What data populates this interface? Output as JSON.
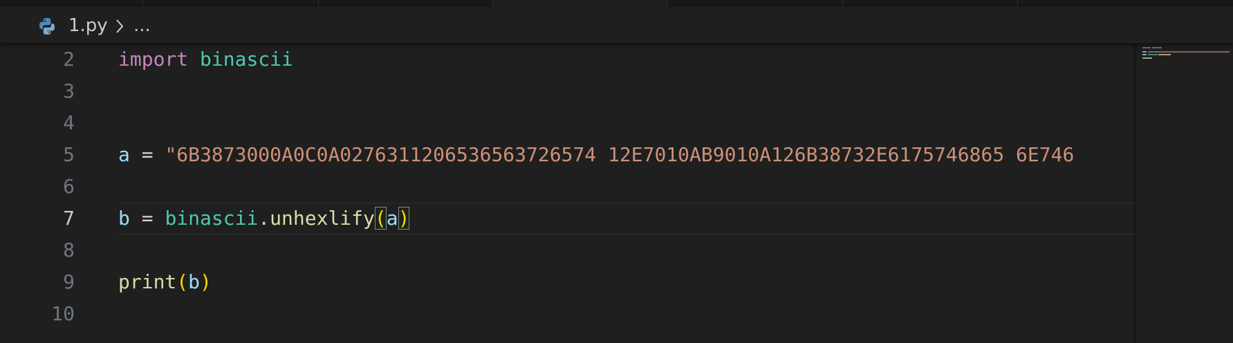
{
  "breadcrumb": {
    "file_name": "1.py",
    "ellipsis": "...",
    "file_icon": "python-icon",
    "separator_icon": "chevron-right-icon"
  },
  "editor": {
    "active_line": "7",
    "line_numbers": [
      "2",
      "3",
      "4",
      "5",
      "6",
      "7",
      "8",
      "9",
      "10"
    ],
    "lines": {
      "l2": {
        "kw": "import",
        "sp": " ",
        "mod": "binascii"
      },
      "l5": {
        "var": "a",
        "eq": " = ",
        "str": "\"6B3873000A0C0A0276311206536563726574 12E7010AB9010A126B38732E6175746865 6E746"
      },
      "l7": {
        "var": "b",
        "eq": " = ",
        "mod": "binascii",
        "dot": ".",
        "fn": "unhexlify",
        "open": "(",
        "arg": "a",
        "close": ")"
      },
      "l9": {
        "fn": "print",
        "open": "(",
        "arg": "b",
        "close": ")"
      }
    }
  },
  "colors": {
    "background": "#1f1f1f",
    "keyword": "#c586c0",
    "module": "#4ec9b0",
    "variable": "#9cdcfe",
    "string": "#ce9178",
    "function": "#dcdcaa",
    "bracket": "#ffd700",
    "line_number": "#6e7681",
    "line_number_active": "#cccccc"
  }
}
